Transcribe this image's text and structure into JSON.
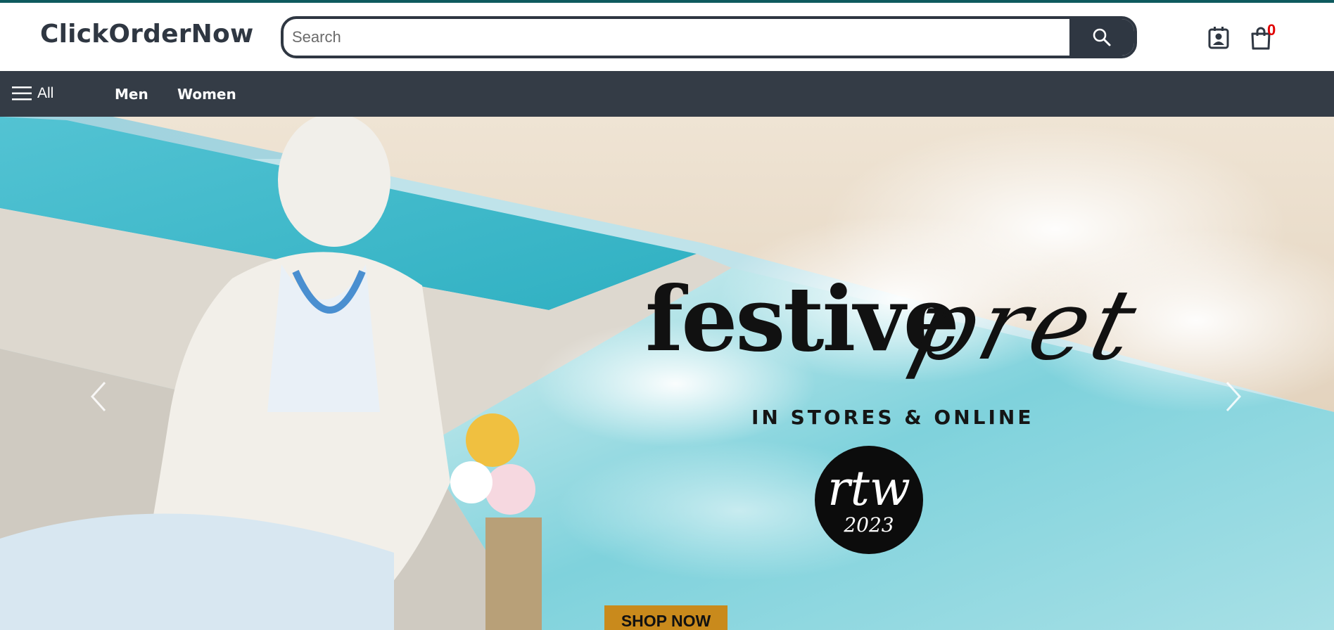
{
  "header": {
    "logo": "ClickOrderNow",
    "search": {
      "placeholder": "Search",
      "value": ""
    },
    "cart_count": "0"
  },
  "icons": {
    "search": "search-icon",
    "profile": "profile-icon",
    "cart": "shopping-bag-icon",
    "menu": "hamburger-menu-icon",
    "prev": "chevron-left-icon",
    "next": "chevron-right-icon"
  },
  "navbar": {
    "all_label": "All",
    "links": [
      {
        "label": "Men"
      },
      {
        "label": "Women"
      }
    ]
  },
  "hero": {
    "title": "festive",
    "script": "pret",
    "subtitle": "IN STORES & ONLINE",
    "badge_main": "rtw",
    "badge_year": "2023",
    "cta": "SHOP NOW"
  },
  "colors": {
    "brand_dark": "#2f3742",
    "navbar": "#343c46",
    "top_accent": "#0e5a5e",
    "cart_badge": "#e00000",
    "cta": "#c98a1c"
  }
}
